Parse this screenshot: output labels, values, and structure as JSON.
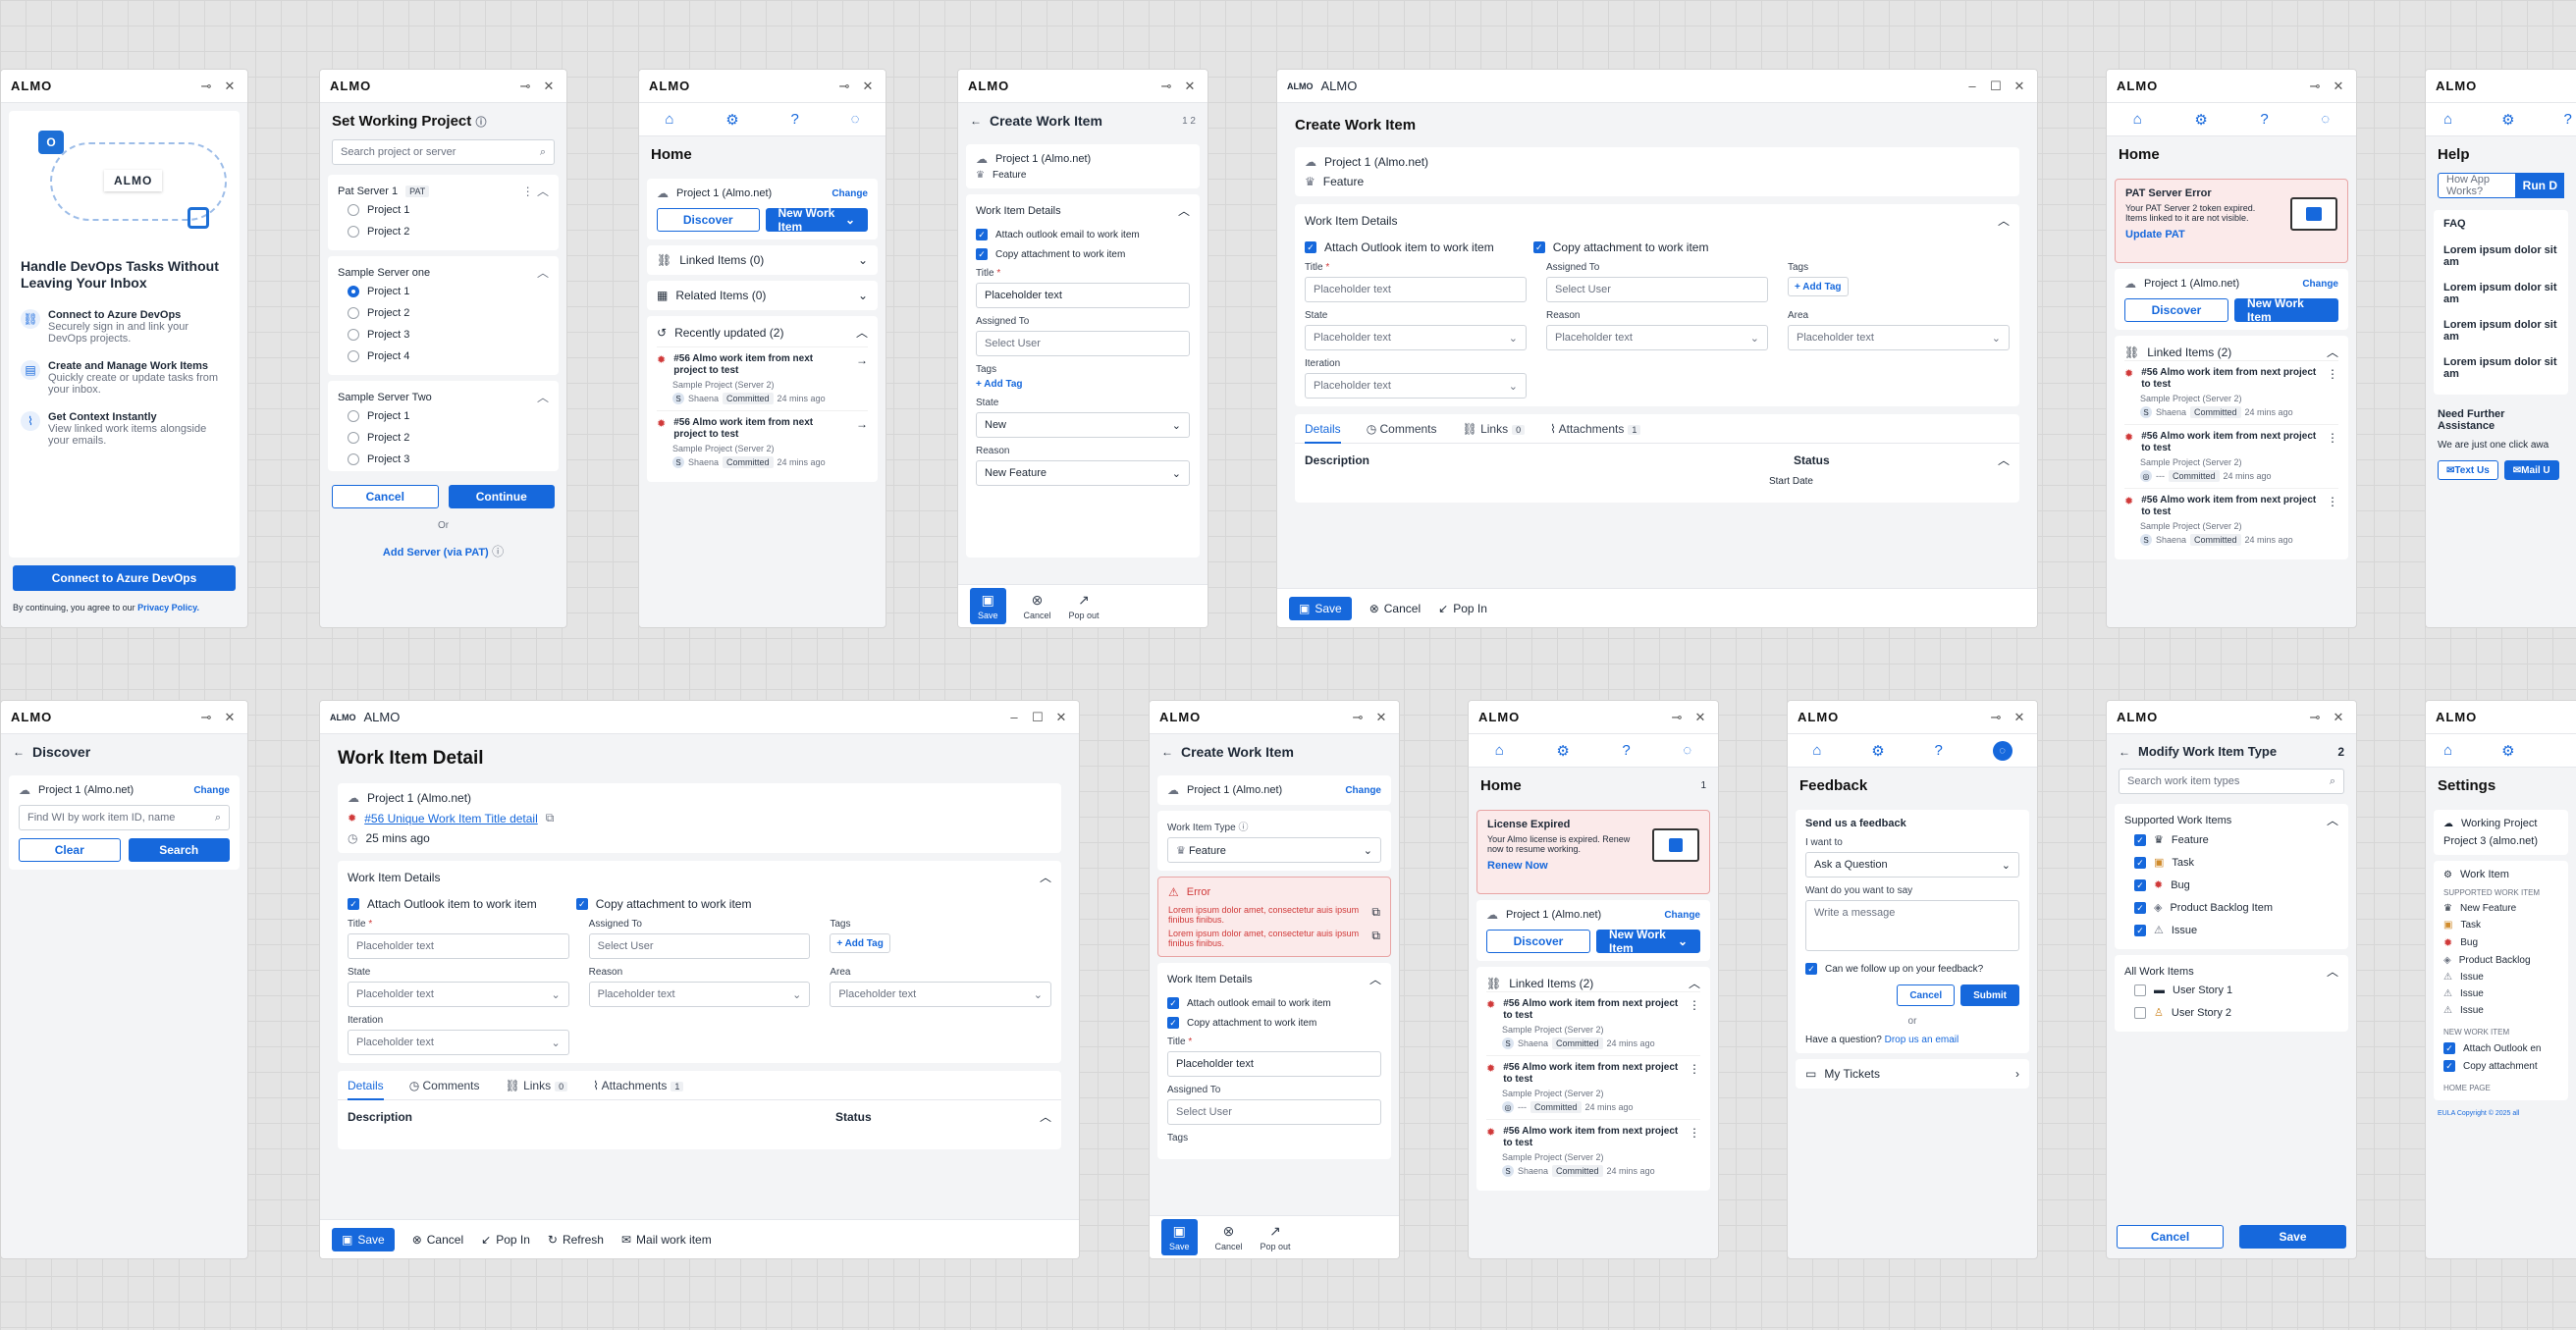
{
  "brand": "ALMO",
  "p1": {
    "headline": "Handle DevOps Tasks Without Leaving Your Inbox",
    "logo_text": "ALMO",
    "features": [
      {
        "title": "Connect to Azure DevOps",
        "desc": "Securely sign in and link your DevOps projects."
      },
      {
        "title": "Create and Manage Work Items",
        "desc": "Quickly create or update tasks from your inbox."
      },
      {
        "title": "Get Context Instantly",
        "desc": "View linked work items alongside your emails."
      }
    ],
    "cta": "Connect to Azure DevOps",
    "terms": "By continuing, you agree to our",
    "privacy": "Privacy Policy."
  },
  "p2": {
    "title": "Set Working Project",
    "search_placeholder": "Search project or server",
    "s1": {
      "name": "Pat Server 1",
      "badge": "PAT",
      "items": [
        "Project 1",
        "Project 2"
      ]
    },
    "s2": {
      "name": "Sample Server one",
      "items": [
        "Project 1",
        "Project 2",
        "Project 3",
        "Project 4"
      ]
    },
    "s3": {
      "name": "Sample Server Two",
      "items": [
        "Project 1",
        "Project 2",
        "Project 3"
      ]
    },
    "cancel": "Cancel",
    "continue": "Continue",
    "or": "Or",
    "add_server": "Add Server (via PAT)"
  },
  "home": {
    "title": "Home",
    "project": "Project 1 (Almo.net)",
    "change": "Change",
    "discover": "Discover",
    "new_wi": "New Work Item",
    "linked": "Linked Items (0)",
    "related": "Related Items (0)",
    "recent": "Recently updated (2)",
    "item_title": "#56 Almo work item from next project to test",
    "item_project": "Sample Project (Server 2)",
    "item_user": "Shaena",
    "item_status": "Committed",
    "item_time": "24 mins ago",
    "item_user_empty": "---"
  },
  "create": {
    "title": "Create Work Item",
    "steps": "1  2",
    "project": "Project 1 (Almo.net)",
    "type": "Feature",
    "details": "Work Item Details",
    "cb1": "Attach outlook email to work item",
    "cb2": "Copy attachment to work item",
    "cb1_wide": "Attach Outlook item to work item",
    "title_lbl": "Title",
    "title_val": "Placeholder text",
    "assigned": "Assigned To",
    "select_user": "Select User",
    "tags": "Tags",
    "add_tag": "+ Add Tag",
    "state": "State",
    "state_val": "New",
    "reason": "Reason",
    "reason_val": "New Feature",
    "iteration": "Iteration",
    "area": "Area",
    "placeholder": "Placeholder text",
    "save": "Save",
    "cancel": "Cancel",
    "popout": "Pop out",
    "popin": "Pop In",
    "refresh": "Refresh",
    "mail": "Mail work item",
    "tab_details": "Details",
    "tab_comments": "Comments",
    "tab_links": "Links",
    "links_count": "0",
    "tab_attach": "Attachments",
    "attach_count": "1",
    "description": "Description",
    "status": "Status",
    "start_date": "Start Date",
    "wi_type": "Work Item Type"
  },
  "pat": {
    "title": "PAT Server Error",
    "desc": "Your PAT Server 2 token expired. Items linked to it are not visible.",
    "action": "Update PAT",
    "linked": "Linked Items (2)"
  },
  "help": {
    "title": "Help",
    "search": "How App Works?",
    "run": "Run D",
    "faq": "FAQ",
    "q": "Lorem ipsum dolor sit am",
    "need": "Need Further Assistance",
    "sub": "We are just one click awa",
    "text": "Text Us",
    "mail": "Mail U"
  },
  "discover": {
    "title": "Discover",
    "project": "Project 1 (Almo.net)",
    "change": "Change",
    "placeholder": "Find WI by work item ID, name",
    "clear": "Clear",
    "search": "Search"
  },
  "detail": {
    "title": "Work Item Detail",
    "project": "Project 1 (Almo.net)",
    "link": "#56 Unique Work Item Title detail",
    "time": "25 mins ago"
  },
  "error": {
    "title": "Error",
    "msg": "Lorem ipsum dolor amet, consectetur auis ipsum finibus finibus."
  },
  "license": {
    "title": "License Expired",
    "desc": "Your Almo license is expired. Renew now to resume working.",
    "action": "Renew Now",
    "count": "1"
  },
  "feedback": {
    "title": "Feedback",
    "send": "Send us a feedback",
    "want": "I want to",
    "want_val": "Ask a Question",
    "say": "Want do you want to say",
    "say_ph": "Write a message",
    "follow": "Can we follow up on your feedback?",
    "cancel": "Cancel",
    "submit": "Submit",
    "or": "or",
    "question": "Have a question?",
    "drop": "Drop us an email",
    "tickets": "My Tickets"
  },
  "modify": {
    "title": "Modify Work Item Type",
    "count": "2",
    "search": "Search work item types",
    "supported": "Supported Work Items",
    "types": [
      "Feature",
      "Task",
      "Bug",
      "Product Backlog Item",
      "Issue"
    ],
    "all": "All Work Items",
    "all_types": [
      "User Story 1",
      "User Story 2"
    ],
    "cancel": "Cancel",
    "save": "Save"
  },
  "settings": {
    "title": "Settings",
    "wp": "Working Project",
    "wp_val": "Project 3 (almo.net)",
    "wi": "Work Item",
    "supported": "SUPPORTED WORK ITEM",
    "types": [
      "New Feature",
      "Task",
      "Bug",
      "Product Backlog",
      "Issue",
      "Issue",
      "Issue"
    ],
    "new_wi": "NEW WORK ITEM",
    "n1": "Attach Outlook en",
    "n2": "Copy attachment",
    "home": "HOME PAGE",
    "eula": "EULA Copyright © 2025 all"
  },
  "colors": {
    "accent": "#1668dc",
    "danger": "#d03939"
  }
}
